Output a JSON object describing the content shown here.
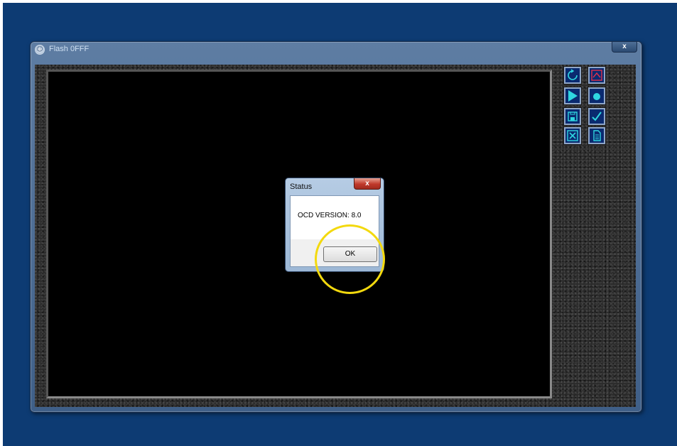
{
  "window": {
    "title": "Flash 0FFF",
    "close_label": "x",
    "icon": "app-logo-icon"
  },
  "toolbar": {
    "buttons": [
      {
        "name": "refresh-icon",
        "color": "#2fd6e0"
      },
      {
        "name": "chart-icon",
        "color": "#e0304a"
      },
      {
        "name": "play-icon",
        "color": "#2fd6e0"
      },
      {
        "name": "record-icon",
        "color": "#2fd6e0"
      },
      {
        "name": "save-icon",
        "color": "#2fd6e0"
      },
      {
        "name": "check-icon",
        "color": "#2fd6e0"
      },
      {
        "name": "delete-icon",
        "color": "#2fd6e0"
      },
      {
        "name": "document-icon",
        "color": "#2fd6e0"
      }
    ]
  },
  "dialog": {
    "title": "Status",
    "close_label": "x",
    "message": "OCD VERSION: 8.0",
    "ok_label": "OK"
  },
  "colors": {
    "desktop": "#0d3b73",
    "highlight": "#f3d90e",
    "button_accent": "#2fd6e0"
  }
}
